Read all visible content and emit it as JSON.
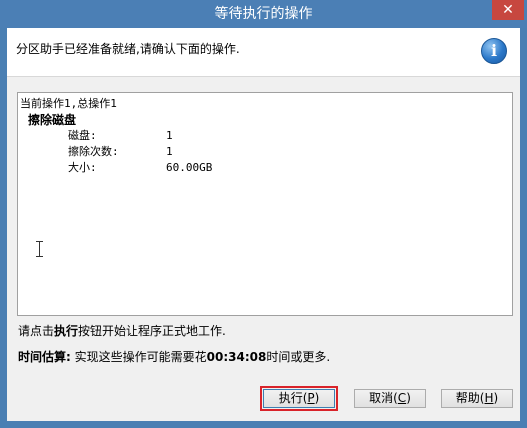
{
  "window": {
    "title": "等待执行的操作",
    "close_glyph": "✕"
  },
  "header": {
    "message": "分区助手已经准备就绪,请确认下面的操作.",
    "icon": "info-icon"
  },
  "operations": {
    "summary": "当前操作1,总操作1",
    "items": [
      {
        "title": "擦除磁盘",
        "details": [
          {
            "key": "磁盘:",
            "value": "1"
          },
          {
            "key": "擦除次数:",
            "value": "1"
          },
          {
            "key": "大小:",
            "value": "60.00GB"
          }
        ]
      }
    ]
  },
  "hint": {
    "prefix": "请点击",
    "bold": "执行",
    "suffix": "按钮开始让程序正式地工作."
  },
  "estimate": {
    "label": "时间估算:",
    "prefix": " 实现这些操作可能需要花",
    "time": "00:34:08",
    "suffix": "时间或更多."
  },
  "buttons": {
    "execute": {
      "label": "执行(",
      "hotkey": "P",
      "end": ")"
    },
    "cancel": {
      "label": "取消(",
      "hotkey": "C",
      "end": ")"
    },
    "help": {
      "label": "帮助(",
      "hotkey": "H",
      "end": ")"
    }
  },
  "colors": {
    "titlebar": "#4b7fb5",
    "close": "#c7473f",
    "focus_outline": "#d9232a"
  }
}
